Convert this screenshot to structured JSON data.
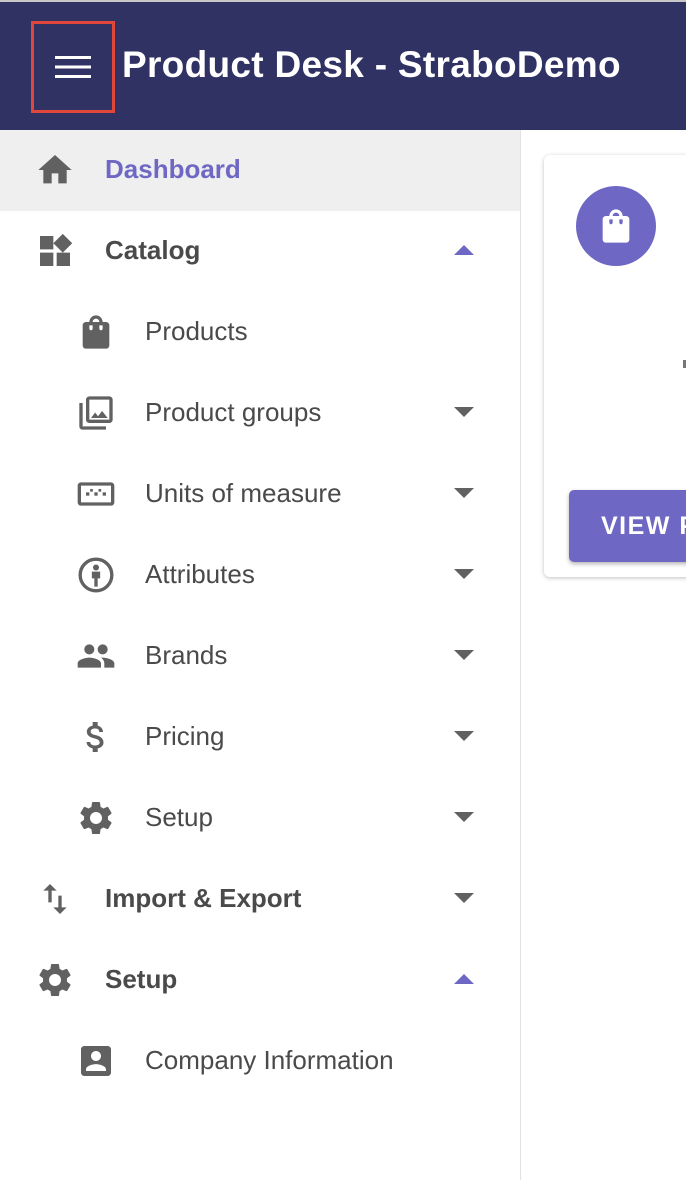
{
  "header": {
    "title": "Product Desk - StraboDemo",
    "menu_icon": "hamburger-menu-icon",
    "background": "#313264",
    "highlight_color": "#e0463a"
  },
  "sidebar": {
    "accent": "#6e68c4",
    "items": [
      {
        "label": "Dashboard",
        "icon": "home-icon",
        "active": true
      },
      {
        "label": "Catalog",
        "icon": "widgets-icon",
        "expanded": true
      },
      {
        "label": "Products",
        "icon": "shopping-bag-icon"
      },
      {
        "label": "Product groups",
        "icon": "photo-library-icon"
      },
      {
        "label": "Units of measure",
        "icon": "ruler-icon"
      },
      {
        "label": "Attributes",
        "icon": "person-circle-icon"
      },
      {
        "label": "Brands",
        "icon": "people-icon"
      },
      {
        "label": "Pricing",
        "icon": "dollar-icon"
      },
      {
        "label": "Setup",
        "icon": "gear-icon"
      },
      {
        "label": "Import & Export",
        "icon": "import-export-icon"
      },
      {
        "label": "Setup",
        "icon": "gear-icon",
        "expanded": true
      },
      {
        "label": "Company Information",
        "icon": "account-box-icon"
      }
    ]
  },
  "card": {
    "icon": "shopping-bag-icon",
    "button_label": "VIEW P"
  }
}
